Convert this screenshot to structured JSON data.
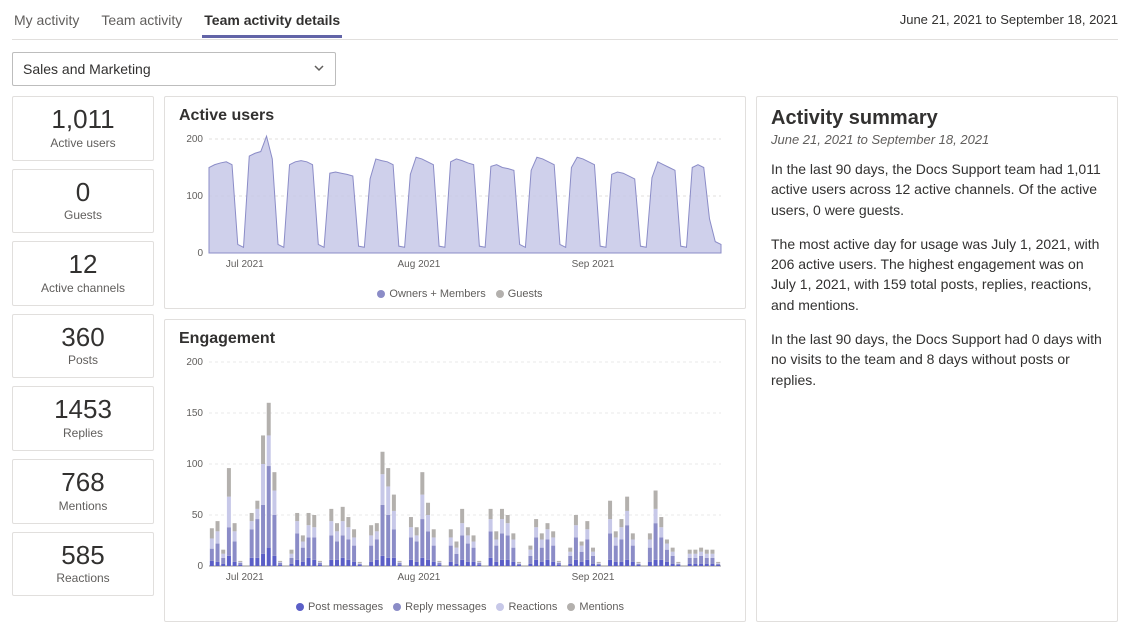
{
  "tabs": [
    {
      "label": "My activity",
      "active": false
    },
    {
      "label": "Team activity",
      "active": false
    },
    {
      "label": "Team activity details",
      "active": true
    }
  ],
  "date_range_top": "June 21, 2021 to September 18, 2021",
  "team_select": {
    "value": "Sales and Marketing"
  },
  "stats": {
    "active_users": {
      "value": "1,011",
      "label": "Active users"
    },
    "guests": {
      "value": "0",
      "label": "Guests"
    },
    "channels": {
      "value": "12",
      "label": "Active channels"
    },
    "posts": {
      "value": "360",
      "label": "Posts"
    },
    "replies": {
      "value": "1453",
      "label": "Replies"
    },
    "mentions": {
      "value": "768",
      "label": "Mentions"
    },
    "reactions": {
      "value": "585",
      "label": "Reactions"
    }
  },
  "colors": {
    "purple_dark": "#5b5fc7",
    "purple_med": "#8b8cc7",
    "purple_light": "#c7c8e8",
    "grey": "#b3b0ad",
    "area_fill": "#c7c8e8",
    "area_stroke": "#8b8cc7"
  },
  "active_users_chart": {
    "title": "Active users",
    "legend": [
      "Owners + Members",
      "Guests"
    ]
  },
  "engagement_chart": {
    "title": "Engagement",
    "legend": [
      "Post messages",
      "Reply messages",
      "Reactions",
      "Mentions"
    ]
  },
  "summary": {
    "title": "Activity summary",
    "drange": "June 21, 2021 to September 18, 2021",
    "p1": "In the last 90 days, the Docs Support team had 1,011 active users across 12 active channels. Of the active users, 0 were guests.",
    "p2": "The most active day for usage was July 1, 2021, with 206 active users. The highest engagement was on July 1, 2021, with 159 total posts, replies, reactions, and mentions.",
    "p3": "In the last 90 days, the Docs Support had 0 days with no visits to the team and 8 days without posts or replies."
  },
  "chart_data": [
    {
      "type": "area",
      "title": "Active users",
      "ylabel": "",
      "ylim": [
        0,
        200
      ],
      "yticks": [
        0,
        100,
        200
      ],
      "xtick_labels": [
        "Jul 2021",
        "Aug 2021",
        "Sep 2021"
      ],
      "series": [
        {
          "name": "Owners + Members",
          "values": [
            150,
            155,
            158,
            160,
            155,
            15,
            10,
            170,
            175,
            178,
            205,
            165,
            15,
            10,
            155,
            160,
            162,
            160,
            155,
            15,
            10,
            140,
            142,
            140,
            138,
            135,
            12,
            10,
            130,
            165,
            162,
            160,
            155,
            12,
            10,
            138,
            168,
            165,
            160,
            155,
            12,
            10,
            160,
            165,
            162,
            158,
            155,
            12,
            10,
            152,
            155,
            150,
            148,
            145,
            15,
            10,
            145,
            168,
            165,
            160,
            155,
            15,
            10,
            150,
            168,
            165,
            160,
            155,
            12,
            10,
            138,
            142,
            140,
            135,
            130,
            12,
            10,
            132,
            160,
            155,
            150,
            145,
            12,
            10,
            150,
            155,
            150,
            60,
            20,
            15
          ]
        },
        {
          "name": "Guests",
          "values": [
            0,
            0,
            0,
            0,
            0,
            0,
            0,
            0,
            0,
            0,
            0,
            0,
            0,
            0,
            0,
            0,
            0,
            0,
            0,
            0,
            0,
            0,
            0,
            0,
            0,
            0,
            0,
            0,
            0,
            0,
            0,
            0,
            0,
            0,
            0,
            0,
            0,
            0,
            0,
            0,
            0,
            0,
            0,
            0,
            0,
            0,
            0,
            0,
            0,
            0,
            0,
            0,
            0,
            0,
            0,
            0,
            0,
            0,
            0,
            0,
            0,
            0,
            0,
            0,
            0,
            0,
            0,
            0,
            0,
            0,
            0,
            0,
            0,
            0,
            0,
            0,
            0,
            0,
            0,
            0,
            0,
            0,
            0,
            0,
            0,
            0,
            0,
            0,
            0,
            0
          ]
        }
      ]
    },
    {
      "type": "bar",
      "title": "Engagement",
      "ylabel": "",
      "ylim": [
        0,
        200
      ],
      "yticks": [
        0,
        50,
        100,
        150,
        200
      ],
      "xtick_labels": [
        "Jul 2021",
        "Aug 2021",
        "Sep 2021"
      ],
      "series_names": [
        "Post messages",
        "Reply messages",
        "Reactions",
        "Mentions"
      ],
      "stacked_values": [
        [
          5,
          12,
          10,
          10
        ],
        [
          4,
          18,
          12,
          10
        ],
        [
          2,
          6,
          4,
          4
        ],
        [
          10,
          28,
          30,
          28
        ],
        [
          4,
          20,
          10,
          8
        ],
        [
          1,
          2,
          1,
          1
        ],
        [
          0,
          0,
          0,
          0
        ],
        [
          8,
          28,
          8,
          8
        ],
        [
          8,
          38,
          10,
          8
        ],
        [
          12,
          48,
          40,
          28
        ],
        [
          18,
          80,
          30,
          32
        ],
        [
          10,
          40,
          24,
          18
        ],
        [
          1,
          2,
          1,
          1
        ],
        [
          0,
          0,
          0,
          0
        ],
        [
          2,
          6,
          4,
          4
        ],
        [
          6,
          26,
          12,
          8
        ],
        [
          4,
          14,
          6,
          6
        ],
        [
          8,
          20,
          12,
          12
        ],
        [
          6,
          22,
          10,
          12
        ],
        [
          1,
          2,
          1,
          1
        ],
        [
          0,
          0,
          0,
          0
        ],
        [
          6,
          24,
          14,
          12
        ],
        [
          6,
          18,
          10,
          8
        ],
        [
          8,
          22,
          14,
          14
        ],
        [
          6,
          20,
          12,
          10
        ],
        [
          4,
          16,
          8,
          8
        ],
        [
          1,
          1,
          1,
          1
        ],
        [
          0,
          0,
          0,
          0
        ],
        [
          4,
          16,
          10,
          10
        ],
        [
          6,
          20,
          8,
          8
        ],
        [
          10,
          50,
          30,
          22
        ],
        [
          8,
          42,
          28,
          18
        ],
        [
          8,
          28,
          18,
          16
        ],
        [
          1,
          2,
          1,
          1
        ],
        [
          0,
          0,
          0,
          0
        ],
        [
          6,
          22,
          10,
          10
        ],
        [
          4,
          20,
          6,
          8
        ],
        [
          8,
          38,
          24,
          22
        ],
        [
          6,
          28,
          16,
          12
        ],
        [
          4,
          16,
          8,
          8
        ],
        [
          1,
          2,
          1,
          1
        ],
        [
          0,
          0,
          0,
          0
        ],
        [
          4,
          16,
          8,
          8
        ],
        [
          2,
          10,
          6,
          6
        ],
        [
          6,
          24,
          12,
          14
        ],
        [
          4,
          18,
          8,
          8
        ],
        [
          4,
          14,
          6,
          6
        ],
        [
          1,
          2,
          1,
          1
        ],
        [
          0,
          0,
          0,
          0
        ],
        [
          8,
          26,
          12,
          10
        ],
        [
          4,
          16,
          6,
          8
        ],
        [
          6,
          26,
          14,
          10
        ],
        [
          6,
          24,
          12,
          8
        ],
        [
          4,
          14,
          8,
          6
        ],
        [
          1,
          1,
          1,
          1
        ],
        [
          0,
          0,
          0,
          0
        ],
        [
          2,
          8,
          6,
          4
        ],
        [
          6,
          22,
          10,
          8
        ],
        [
          4,
          14,
          8,
          6
        ],
        [
          6,
          20,
          10,
          6
        ],
        [
          4,
          16,
          8,
          6
        ],
        [
          1,
          2,
          1,
          1
        ],
        [
          0,
          0,
          0,
          0
        ],
        [
          2,
          8,
          4,
          4
        ],
        [
          6,
          22,
          12,
          10
        ],
        [
          4,
          10,
          6,
          4
        ],
        [
          6,
          20,
          10,
          8
        ],
        [
          2,
          8,
          4,
          4
        ],
        [
          1,
          1,
          1,
          1
        ],
        [
          0,
          0,
          0,
          0
        ],
        [
          6,
          26,
          14,
          18
        ],
        [
          4,
          16,
          8,
          6
        ],
        [
          4,
          22,
          12,
          8
        ],
        [
          6,
          34,
          14,
          14
        ],
        [
          4,
          16,
          6,
          6
        ],
        [
          1,
          1,
          1,
          1
        ],
        [
          0,
          0,
          0,
          0
        ],
        [
          4,
          14,
          8,
          6
        ],
        [
          6,
          36,
          14,
          18
        ],
        [
          6,
          22,
          10,
          10
        ],
        [
          4,
          12,
          6,
          4
        ],
        [
          2,
          8,
          4,
          4
        ],
        [
          1,
          1,
          1,
          1
        ],
        [
          0,
          0,
          0,
          0
        ],
        [
          2,
          6,
          4,
          4
        ],
        [
          2,
          6,
          4,
          4
        ],
        [
          2,
          8,
          4,
          4
        ],
        [
          2,
          6,
          4,
          4
        ],
        [
          2,
          6,
          4,
          4
        ],
        [
          1,
          1,
          1,
          1
        ]
      ]
    }
  ]
}
